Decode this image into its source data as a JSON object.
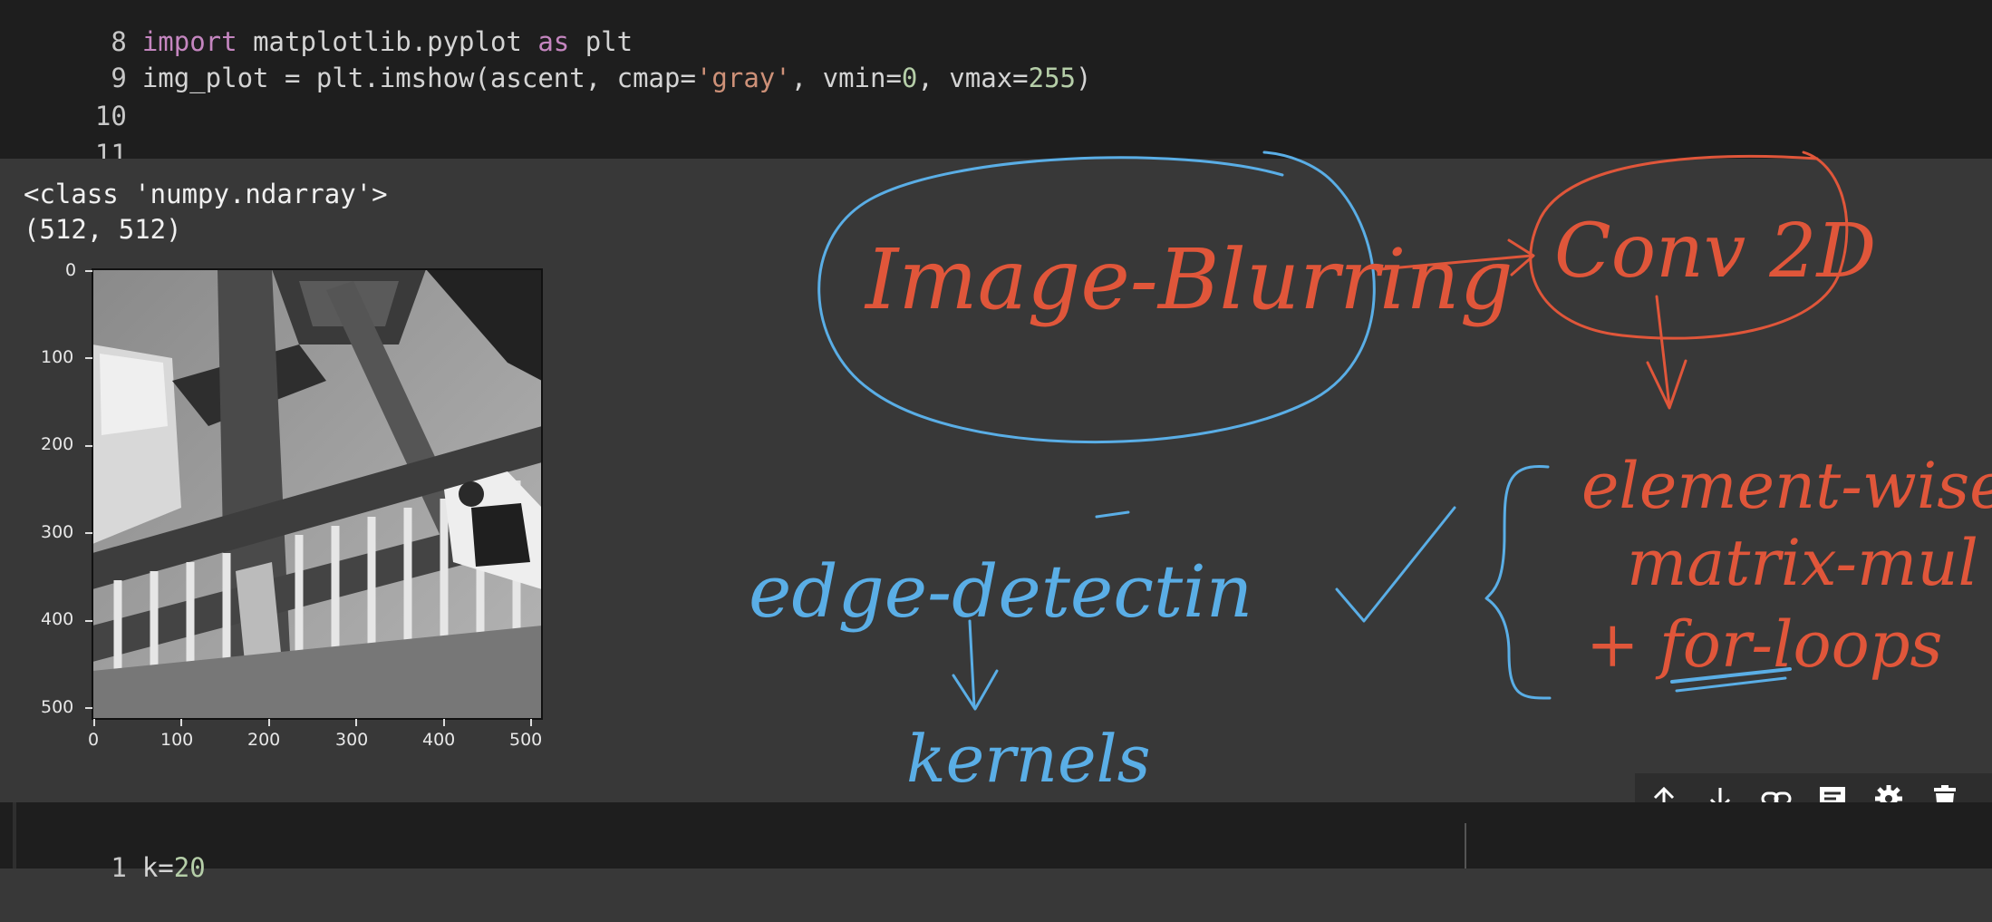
{
  "code_cell": {
    "lines": [
      {
        "num": "8",
        "parts": [
          {
            "t": "import",
            "c": "kw"
          },
          {
            "t": " matplotlib.pyplot ",
            "c": ""
          },
          {
            "t": "as",
            "c": "kw"
          },
          {
            "t": " plt",
            "c": ""
          }
        ]
      },
      {
        "num": "9",
        "parts": [
          {
            "t": "img_plot = plt.imshow(ascent, cmap=",
            "c": ""
          },
          {
            "t": "'gray'",
            "c": "str"
          },
          {
            "t": ", vmin=",
            "c": ""
          },
          {
            "t": "0",
            "c": "num"
          },
          {
            "t": ", vmax=",
            "c": ""
          },
          {
            "t": "255",
            "c": "num"
          },
          {
            "t": ")",
            "c": ""
          }
        ]
      },
      {
        "num": "10",
        "parts": []
      },
      {
        "num": "11",
        "parts": []
      }
    ]
  },
  "output": {
    "type_line": "<class 'numpy.ndarray'>",
    "shape_line": "(512, 512)",
    "plot": {
      "y_ticks": [
        "0",
        "100",
        "200",
        "300",
        "400",
        "500"
      ],
      "x_ticks": [
        "0",
        "100",
        "200",
        "300",
        "400",
        "500"
      ]
    }
  },
  "annotations": {
    "image_blurring": "Image-Blurring",
    "conv2d": "Conv 2D",
    "edge_detection": "edge-detectin",
    "kernels": "kernels",
    "element_wise": "element-wise",
    "matrix_mul": "matrix-mul",
    "for_loops": "+ for-loops",
    "colors": {
      "blue": "#5aaee6",
      "red": "#e0563a"
    }
  },
  "toolbar": {
    "icons": [
      "move-up-icon",
      "move-down-icon",
      "link-icon",
      "comment-icon",
      "settings-icon",
      "delete-icon"
    ]
  },
  "next_cell": {
    "line_num": "1",
    "code_parts": [
      {
        "t": "k=",
        "c": ""
      },
      {
        "t": "20",
        "c": "num"
      }
    ]
  }
}
